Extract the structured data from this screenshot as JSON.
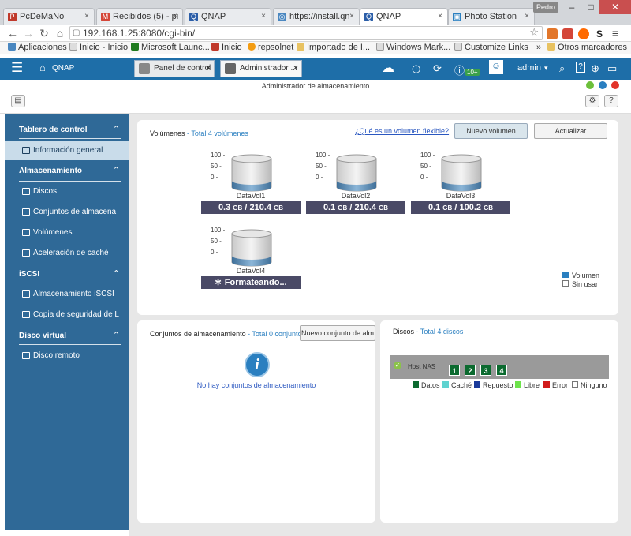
{
  "browser": {
    "tabs": [
      {
        "label": "PcDeMaNo",
        "color": "#c0392b"
      },
      {
        "label": "Recibidos (5) - pi",
        "color": "#d44638"
      },
      {
        "label": "QNAP",
        "color": "#2b5ea8"
      },
      {
        "label": "https://install.qn",
        "color": "#4a87c0"
      },
      {
        "label": "QNAP",
        "color": "#2b5ea8"
      },
      {
        "label": "Photo Station",
        "color": "#2a7fc0"
      }
    ],
    "user": "Pedro",
    "url": "192.168.1.25:8080/cgi-bin/",
    "bookmarks": [
      "Aplicaciones",
      "Inicio - Inicio",
      "Microsoft Launc...",
      "Inicio",
      "repsolnet",
      "Importado de I...",
      "Windows Mark...",
      "Customize Links",
      "»",
      "Otros marcadores"
    ]
  },
  "qnap": {
    "brand": "QNAP",
    "tabs": [
      "Panel de control",
      "Administrador ..."
    ],
    "notif_badge": "10+",
    "admin": "admin",
    "window_title": "Administrador de almacenamiento"
  },
  "sidebar": {
    "sections": [
      {
        "label": "Tablero de control",
        "items": [
          "Información general"
        ]
      },
      {
        "label": "Almacenamiento",
        "items": [
          "Discos",
          "Conjuntos de almacena",
          "Volúmenes",
          "Aceleración de caché"
        ]
      },
      {
        "label": "iSCSI",
        "items": [
          "Almacenamiento iSCSI",
          "Copia de seguridad de L"
        ]
      },
      {
        "label": "Disco virtual",
        "items": [
          "Disco remoto"
        ]
      }
    ]
  },
  "volumes_panel": {
    "title": "Volúmenes",
    "subtitle": "- Total 4 volúmenes",
    "link": "¿Qué es un volumen flexible?",
    "new_button": "Nuevo volumen",
    "refresh_button": "Actualizar",
    "axis_ticks": [
      "100",
      "50",
      "0"
    ],
    "volumes": [
      {
        "name": "DataVol1",
        "used": "0.3",
        "unit1": "GB",
        "total": "210.4",
        "unit2": "GB",
        "fill_fraction": 0.0015
      },
      {
        "name": "DataVol2",
        "used": "0.1",
        "unit1": "GB",
        "total": "210.4",
        "unit2": "GB",
        "fill_fraction": 0.0005
      },
      {
        "name": "DataVol3",
        "used": "0.1",
        "unit1": "GB",
        "total": "100.2",
        "unit2": "GB",
        "fill_fraction": 0.001
      },
      {
        "name": "DataVol4",
        "status": "Formateando...",
        "fill_fraction": 0
      }
    ],
    "legend": [
      "Volumen",
      "Sin usar"
    ]
  },
  "pools_panel": {
    "title": "Conjuntos de almacenamiento",
    "subtitle": "- Total 0 conjuntos",
    "new_button": "Nuevo conjunto de alm",
    "empty": "No hay conjuntos de almacenamiento"
  },
  "disks_panel": {
    "title": "Discos",
    "subtitle": "- Total 4 discos",
    "host": "Host NAS",
    "disks": [
      "1",
      "2",
      "3",
      "4"
    ],
    "legend": [
      {
        "label": "Datos",
        "color": "#0b6a2f"
      },
      {
        "label": "Caché",
        "color": "#5fd3d0"
      },
      {
        "label": "Repuesto",
        "color": "#1a3a9a"
      },
      {
        "label": "Libre",
        "color": "#6ee34b"
      },
      {
        "label": "Error",
        "color": "#d11b1b"
      },
      {
        "label": "Ninguno",
        "color": "#ffffff"
      }
    ]
  }
}
